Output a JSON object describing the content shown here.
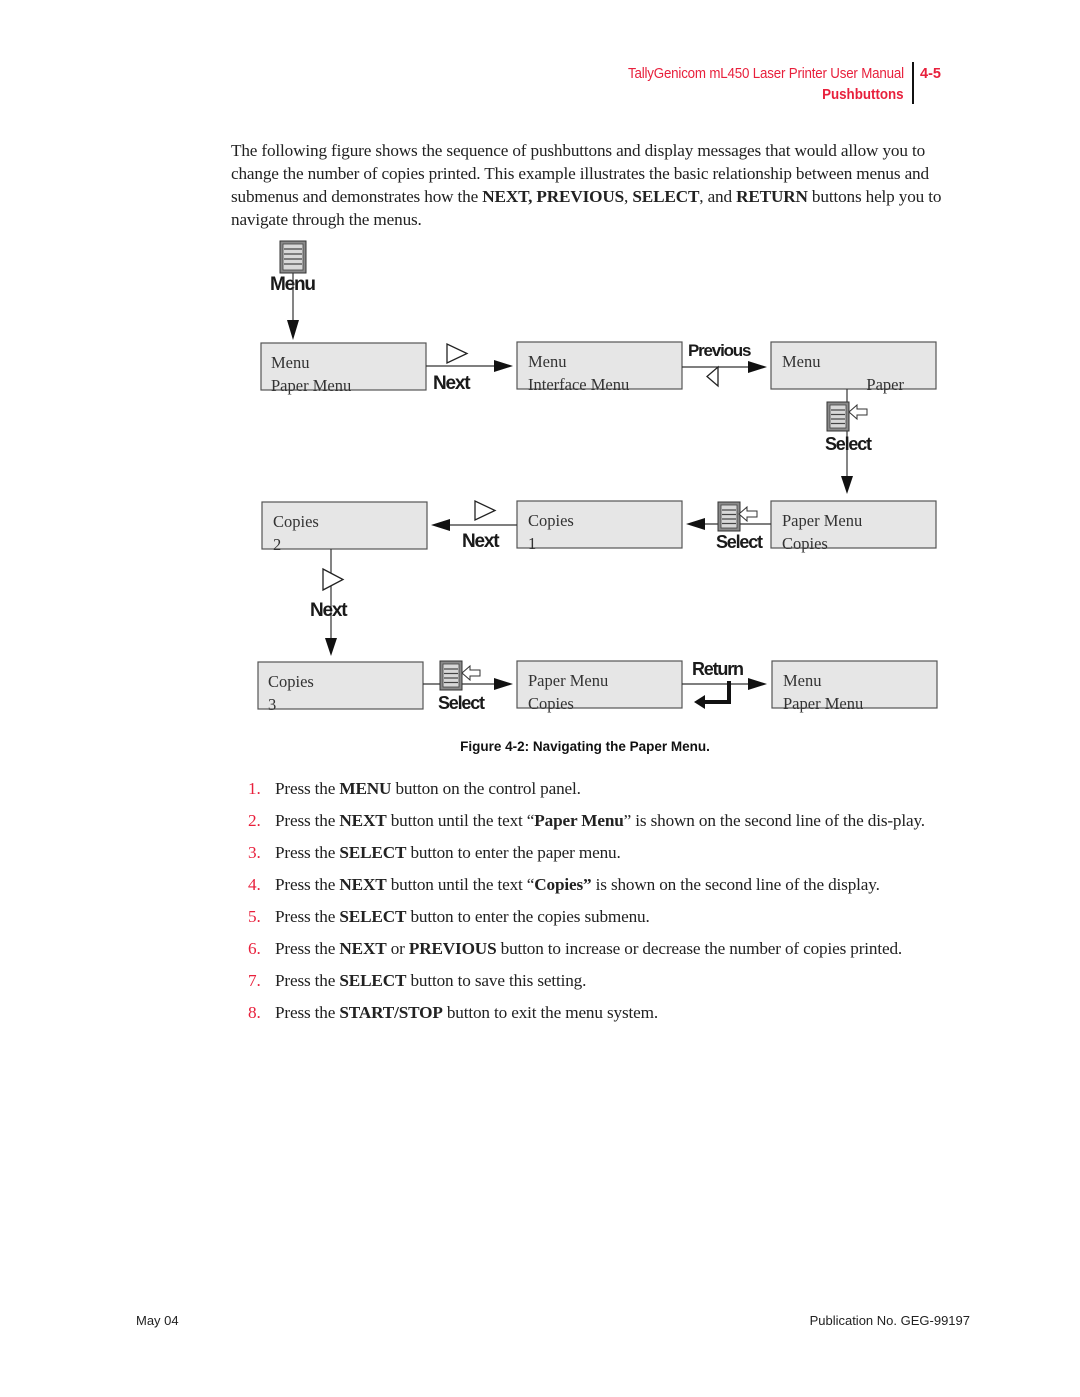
{
  "header": {
    "manual_title": "TallyGenicom mL450 Laser Printer User Manual",
    "section": "Pushbuttons",
    "page_number": "4-5"
  },
  "intro": {
    "segments": [
      {
        "text": "The following figure shows the sequence of pushbuttons and display messages that would allow you to change the number of copies printed. This example illustrates the basic relationship between menus and submenus and demonstrates how the ",
        "bold": false
      },
      {
        "text": "NEXT, PREVIOUS",
        "bold": true
      },
      {
        "text": ", ",
        "bold": false
      },
      {
        "text": "SELECT",
        "bold": true
      },
      {
        "text": ", and ",
        "bold": false
      },
      {
        "text": "RETURN",
        "bold": true
      },
      {
        "text": " buttons help you to navigate through the menus.",
        "bold": false
      }
    ]
  },
  "figure": {
    "displays": {
      "d1": {
        "line1": "Menu",
        "line2": "Paper Menu"
      },
      "d2": {
        "line1": "Menu",
        "line2": "Interface Menu"
      },
      "d3": {
        "line1": "Menu",
        "line2": "Paper"
      },
      "d4": {
        "line1": "Paper Menu",
        "line2": "Copies"
      },
      "d5": {
        "line1": "Copies",
        "line2": "1"
      },
      "d6": {
        "line1": "Copies",
        "line2": "2"
      },
      "d7": {
        "line1": "Copies",
        "line2": "3"
      },
      "d8": {
        "line1": "Paper Menu",
        "line2": "Copies"
      },
      "d9": {
        "line1": "Menu",
        "line2": "Paper Menu"
      }
    },
    "buttons": {
      "menu": "Menu",
      "next": "Next",
      "previous": "Previous",
      "select": "Select",
      "return": "Return"
    },
    "caption": "Figure 4-2:  Navigating the Paper Menu."
  },
  "steps": [
    {
      "num": "1.",
      "segments": [
        {
          "text": "Press the ",
          "bold": false
        },
        {
          "text": "MENU",
          "bold": true
        },
        {
          "text": " button on the control panel.",
          "bold": false
        }
      ]
    },
    {
      "num": "2.",
      "segments": [
        {
          "text": "Press the ",
          "bold": false
        },
        {
          "text": "NEXT",
          "bold": true
        },
        {
          "text": " button until the text “",
          "bold": false
        },
        {
          "text": "Paper Menu",
          "bold": true
        },
        {
          "text": "” is shown on the second line of the dis-play.",
          "bold": false
        }
      ]
    },
    {
      "num": "3.",
      "segments": [
        {
          "text": "Press the ",
          "bold": false
        },
        {
          "text": "SELECT",
          "bold": true
        },
        {
          "text": " button to enter the paper menu.",
          "bold": false
        }
      ]
    },
    {
      "num": "4.",
      "segments": [
        {
          "text": "Press the ",
          "bold": false
        },
        {
          "text": "NEXT",
          "bold": true
        },
        {
          "text": " button until the text “",
          "bold": false
        },
        {
          "text": "Copies”",
          "bold": true
        },
        {
          "text": " is shown on the second line of the display.",
          "bold": false
        }
      ]
    },
    {
      "num": "5.",
      "segments": [
        {
          "text": "Press the ",
          "bold": false
        },
        {
          "text": "SELECT",
          "bold": true
        },
        {
          "text": " button to enter the copies submenu.",
          "bold": false
        }
      ]
    },
    {
      "num": "6.",
      "segments": [
        {
          "text": "Press the ",
          "bold": false
        },
        {
          "text": "NEXT",
          "bold": true
        },
        {
          "text": " or ",
          "bold": false
        },
        {
          "text": "PREVIOUS",
          "bold": true
        },
        {
          "text": " button to increase or decrease the number of copies printed.",
          "bold": false
        }
      ]
    },
    {
      "num": "7.",
      "segments": [
        {
          "text": "Press the ",
          "bold": false
        },
        {
          "text": "SELECT",
          "bold": true
        },
        {
          "text": " button to save this setting.",
          "bold": false
        }
      ]
    },
    {
      "num": "8.",
      "segments": [
        {
          "text": "Press the ",
          "bold": false
        },
        {
          "text": "START/STOP",
          "bold": true
        },
        {
          "text": " button to exit the menu system.",
          "bold": false
        }
      ]
    }
  ],
  "footer": {
    "date": "May 04",
    "publication": "Publication No. GEG-99197"
  }
}
